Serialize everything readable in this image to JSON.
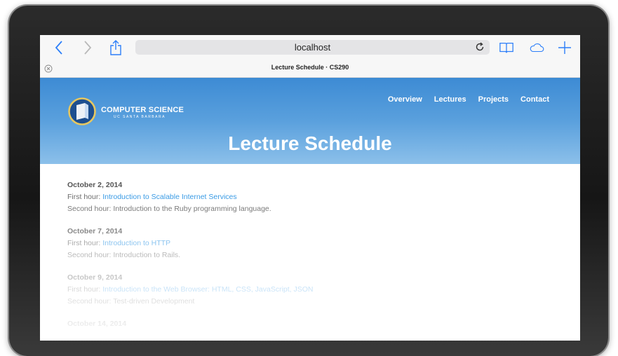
{
  "browser": {
    "url": "localhost",
    "tab_title": "Lecture Schedule · CS290"
  },
  "site": {
    "logo_title": "COMPUTER SCIENCE",
    "logo_subtitle": "UC SANTA BARBARA",
    "nav": [
      "Overview",
      "Lectures",
      "Projects",
      "Contact"
    ],
    "page_title": "Lecture Schedule"
  },
  "lectures": [
    {
      "date": "October 2, 2014",
      "first_label": "First hour: ",
      "first_link": "Introduction to Scalable Internet Services",
      "second": "Second hour: Introduction to the Ruby programming language."
    },
    {
      "date": "October 7, 2014",
      "first_label": "First hour: ",
      "first_link": "Introduction to HTTP",
      "second": "Second hour: Introduction to Rails."
    },
    {
      "date": "October 9, 2014",
      "first_label": "First hour: ",
      "first_link": "Introduction to the Web Browser: HTML, CSS, JavaScript, JSON",
      "second": "Second hour: Test-driven Development"
    },
    {
      "date": "October 14, 2014"
    }
  ],
  "colors": {
    "accent": "#3a9be5",
    "hero_top": "#3d8bd4",
    "hero_bottom": "#8cc0ea"
  }
}
